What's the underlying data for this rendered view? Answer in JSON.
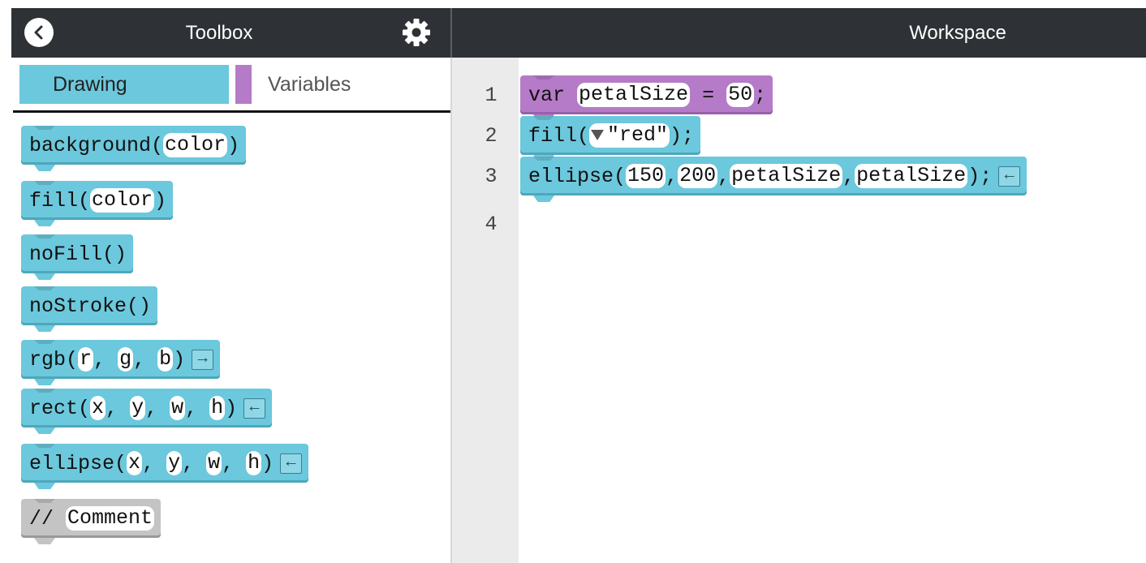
{
  "header": {
    "toolbox_title": "Toolbox",
    "workspace_title": "Workspace",
    "back_icon": "back-arrow-icon",
    "settings_icon": "gear-icon"
  },
  "tabs": {
    "drawing": "Drawing",
    "variables": "Variables"
  },
  "colors": {
    "header_bg": "#2e3135",
    "drawing_block": "#6cc8dc",
    "variable_block": "#b57bc8",
    "comment_block": "#c4c4c4"
  },
  "toolbox_blocks": {
    "background": {
      "name": "background",
      "open": "(",
      "arg": "color",
      "close": ")"
    },
    "fill": {
      "name": "fill",
      "open": "(",
      "arg": "color",
      "close": ")"
    },
    "nofill": {
      "text": "noFill()"
    },
    "nostroke": {
      "text": "noStroke()"
    },
    "rgb": {
      "name": "rgb",
      "open": "(",
      "args": [
        "r",
        "g",
        "b"
      ],
      "close": ")",
      "arrow": "→"
    },
    "rect": {
      "name": "rect",
      "open": "(",
      "args": [
        "x",
        "y",
        "w",
        "h"
      ],
      "close": ")",
      "arrow": "←"
    },
    "ellipse": {
      "name": "ellipse",
      "open": "(",
      "args": [
        "x",
        "y",
        "w",
        "h"
      ],
      "close": ")",
      "arrow": "←"
    },
    "comment": {
      "prefix": "//",
      "text": "Comment"
    }
  },
  "workspace": {
    "line_numbers": [
      "1",
      "2",
      "3",
      "4"
    ],
    "line1": {
      "keyword": "var",
      "name": "petalSize",
      "eq": "=",
      "value": "50",
      "end": ";"
    },
    "line2": {
      "name": "fill",
      "open": "(",
      "value": "\"red\"",
      "close": ");"
    },
    "line3": {
      "name": "ellipse",
      "open": "(",
      "args": [
        "150",
        "200",
        "petalSize",
        "petalSize"
      ],
      "close": ");",
      "arrow": "←"
    }
  }
}
